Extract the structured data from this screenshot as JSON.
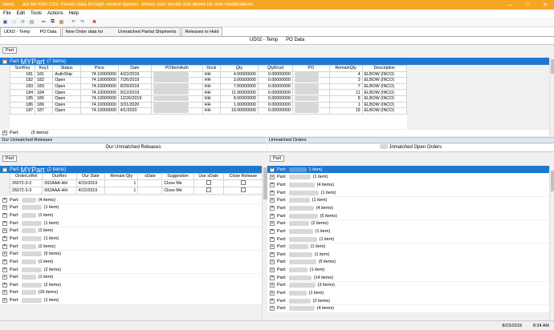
{
  "titlebar": {
    "text": "Takes      ata file from CSV. Parses data through several queries. Shows user results and allows for user modifications.",
    "minimize": "—",
    "maximize": "□",
    "close": "✕",
    "color": "#f5a623"
  },
  "menu": [
    "File",
    "Edit",
    "Tools",
    "Actions",
    "Help"
  ],
  "toolbar_icons": [
    "save-icon",
    "new-icon",
    "refresh-icon",
    "export-icon",
    "cut-icon",
    "copy-icon",
    "paste-icon",
    "undo-icon",
    "redo-icon",
    "delete-icon"
  ],
  "tabs": [
    {
      "label": "UD02 - Temp        PO Data",
      "active": true
    },
    {
      "label": "New Order data for            Unmatched Partial Shipments",
      "active": false
    },
    {
      "label": "Releases to Hold",
      "active": false
    }
  ],
  "top_panel": {
    "header": "UD02 - Temp      PO Data",
    "group_chip": "Part",
    "group_label": "Part: ",
    "group_name": "MYPart",
    "group_count": "(7 items)",
    "columns": [
      "SortKey",
      "Key1",
      "Status",
      "Price",
      "Date",
      "POItemAuth",
      "Dock",
      "Qty",
      "QtyRcvd",
      "PO",
      "RemainQty",
      "Description"
    ],
    "rows": [
      {
        "sortkey": "181",
        "key1": "181",
        "status": "AuthShip",
        "price": "74.10000000",
        "date": "4/22/2019",
        "dock": "HH",
        "qty": "4.00000000",
        "qtyrcvd": "0.00000000",
        "remain": "4",
        "desc": "ELBOW (INCO)"
      },
      {
        "sortkey": "182",
        "key1": "182",
        "status": "Open",
        "price": "74.10000000",
        "date": "7/26/2019",
        "dock": "HH",
        "qty": "3.00000000",
        "qtyrcvd": "0.00000000",
        "remain": "3",
        "desc": "ELBOW (INCO)"
      },
      {
        "sortkey": "183",
        "key1": "183",
        "status": "Open",
        "price": "74.10000000",
        "date": "8/29/2019",
        "dock": "HH",
        "qty": "7.00000000",
        "qtyrcvd": "0.00000000",
        "remain": "7",
        "desc": "ELBOW (INCO)"
      },
      {
        "sortkey": "184",
        "key1": "184",
        "status": "Open",
        "price": "74.10000000",
        "date": "9/12/2019",
        "dock": "HH",
        "qty": "11.00000000",
        "qtyrcvd": "0.00000000",
        "remain": "11",
        "desc": "ELBOW (INCO)"
      },
      {
        "sortkey": "185",
        "key1": "185",
        "status": "Open",
        "price": "74.10000000",
        "date": "12/26/2019",
        "dock": "HH",
        "qty": "8.00000000",
        "qtyrcvd": "0.00000000",
        "remain": "8",
        "desc": "ELBOW (INCO)"
      },
      {
        "sortkey": "186",
        "key1": "186",
        "status": "Open",
        "price": "74.10000000",
        "date": "3/31/2020",
        "dock": "HH",
        "qty": "1.00000000",
        "qtyrcvd": "0.00000000",
        "remain": "1",
        "desc": "ELBOW (INCO)"
      },
      {
        "sortkey": "187",
        "key1": "187",
        "status": "Open",
        "price": "74.10000000",
        "date": "4/1/2020",
        "dock": "HH",
        "qty": "19.00000000",
        "qtyrcvd": "0.00000000",
        "remain": "19",
        "desc": "ELBOW (INCO)"
      }
    ],
    "next_group": "Part:          (5 items)"
  },
  "left_panel": {
    "split_title": "Our Unmatched Releases",
    "header": "Our Unmatched Releases",
    "group_chip": "Part",
    "group_label": "Part: ",
    "group_name": "MYPart",
    "group_count": "(2 items)",
    "columns": [
      "OrderLnRel",
      "OurRev",
      "Our Date",
      "Remain Qty",
      "xDate",
      "Suggestion",
      "Use xDate",
      "Close Release"
    ],
    "rows": [
      {
        "rel": "26072-3-2",
        "rev": "002AAA-HH",
        "date": "4/15/2019",
        "qty": "1",
        "suggestion": "Close Me"
      },
      {
        "rel": "26072-3-3",
        "rev": "002AAA-HH",
        "date": "4/22/2019",
        "qty": "1",
        "suggestion": "Close Me"
      }
    ],
    "groups": [
      "(4 items)",
      "(1 item)",
      "(1 item)",
      "(1 item)",
      "(1 item)",
      "(1 item)",
      "(2 items)",
      "(5 items)",
      "(1 item)",
      "(2 items)",
      "(1 item)",
      "(2 items)",
      "(16 items)",
      "(1 item)"
    ]
  },
  "right_panel": {
    "split_title": "Unmatched Orders",
    "header": "Jnmatched Open Orders",
    "group_chip": "Part",
    "groups": [
      "1 item)",
      "(1 item)",
      "(4 items)",
      "(1 item)",
      "(1 item)",
      "(4 items)",
      "(5 items)",
      "(2 items)",
      "(1 item)",
      "(1 item)",
      "(1 item)",
      "(1 item)",
      "(5 items)",
      "(1 item)",
      "(14 items)",
      "(3 items)",
      "(1 item)",
      "(2 items)",
      "(4 items)"
    ]
  },
  "status": {
    "date": "8/23/2019",
    "time": "8:34 AM"
  }
}
